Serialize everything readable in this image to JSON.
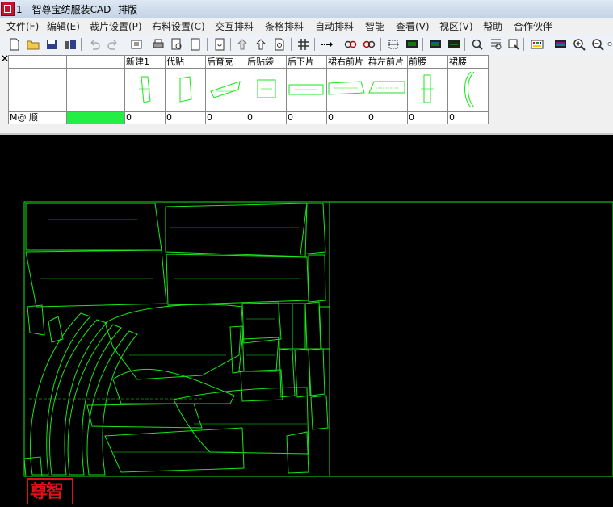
{
  "window": {
    "title": "1 - 智尊宝纺服装CAD--排版"
  },
  "menu": [
    "文件(F)",
    "编辑(E)",
    "裁片设置(P)",
    "布料设置(C)",
    "交互排料",
    "条格排料",
    "自动排料",
    "智能",
    "查看(V)",
    "视区(V)",
    "帮助",
    "合作伙伴"
  ],
  "toolbar_icons": [
    "new-file-icon",
    "open-folder-icon",
    "save-icon",
    "save-all-icon",
    "undo-icon",
    "redo-icon",
    "import-icon",
    "print-icon",
    "print-preview-icon",
    "document-icon",
    "refresh-icon",
    "move-up-icon",
    "rotate-icon",
    "grid-icon",
    "arrow-right-icon",
    "link-icon",
    "unlink-icon",
    "fold-icon",
    "layout-icon",
    "piece-list-icon",
    "palette-icon",
    "search-icon",
    "select-icon",
    "inspect-icon",
    "color-picker-icon",
    "zoom-in-icon",
    "zoom-out-icon",
    "zoom-fit-icon"
  ],
  "pieces": {
    "row_label": "M@ 顺",
    "indicator_color": "#22ee44",
    "columns": [
      {
        "name": "新建1",
        "count": "0"
      },
      {
        "name": "代贴",
        "count": "0"
      },
      {
        "name": "后育克",
        "count": "0"
      },
      {
        "name": "后贴袋",
        "count": "0"
      },
      {
        "name": "后下片",
        "count": "0"
      },
      {
        "name": "裙右前片",
        "count": "0"
      },
      {
        "name": "群左前片",
        "count": "0"
      },
      {
        "name": "前腰",
        "count": "0"
      },
      {
        "name": "裙腰",
        "count": "0"
      }
    ]
  },
  "canvas": {
    "piece_color": "#19e619",
    "background": "#000000"
  },
  "logo": {
    "text": "智尊宝纺"
  }
}
